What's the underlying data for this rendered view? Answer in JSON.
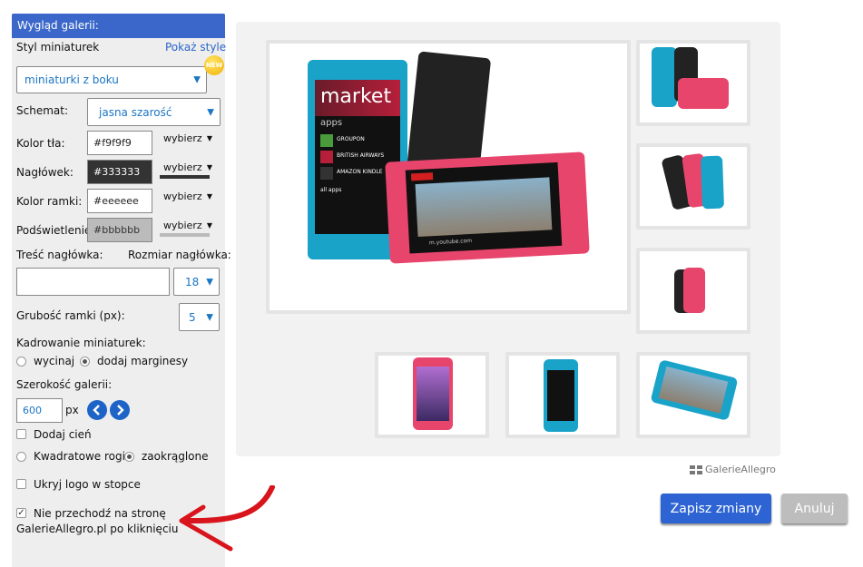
{
  "panel": {
    "title": "Wygląd galerii:",
    "thumb_style_label": "Styl miniaturek",
    "show_styles_link": "Pokaż style",
    "thumb_style_value": "miniaturki z boku",
    "badge": "NEW",
    "scheme_label": "Schemat:",
    "scheme_value": "jasna szarość",
    "bg_color_label": "Kolor tła:",
    "bg_color_value": "#f9f9f9",
    "header_label": "Nagłówek:",
    "header_value": "#333333",
    "border_color_label": "Kolor ramki:",
    "border_color_value": "#eeeeee",
    "highlight_label": "Podświetlenie:",
    "highlight_value": "#bbbbbb",
    "picker_label": "wybierz",
    "header_text_label": "Treść nagłówka:",
    "header_size_label": "Rozmiar nagłówka:",
    "header_text_value": "",
    "header_size_value": "18",
    "border_width_label": "Grubość ramki (px):",
    "border_width_value": "5",
    "cropping_label": "Kadrowanie miniaturek:",
    "crop_option": "wycinaj",
    "margin_option": "dodaj marginesy",
    "gallery_width_label": "Szerokość galerii:",
    "gallery_width_value": "600",
    "px_unit": "px",
    "shadow_label": "Dodaj cień",
    "square_corners_label": "Kwadratowe rogi",
    "rounded_label": "zaokrąglone",
    "hide_logo_label": "Ukryj logo w stopce",
    "no_redirect_line1": "Nie przechodź na stronę",
    "no_redirect_line2": "GalerieAllegro.pl po kliknięciu"
  },
  "colors": {
    "header_swatch": "#333333",
    "highlight_swatch": "#bbbbbb",
    "accent": "#2d63d3",
    "arrow": "#d8141c"
  },
  "gallery": {
    "main_screen_title": "market",
    "main_screen_sub": "apps",
    "main_screen_items": [
      "GROUPON",
      "BRITISH AIRWAYS",
      "AMAZON KINDLE",
      "all apps"
    ],
    "browser_url": "m.youtube.com",
    "thumb_count": 7
  },
  "footer": {
    "brand": "GalerieAllegro",
    "save_label": "Zapisz zmiany",
    "cancel_label": "Anuluj"
  }
}
